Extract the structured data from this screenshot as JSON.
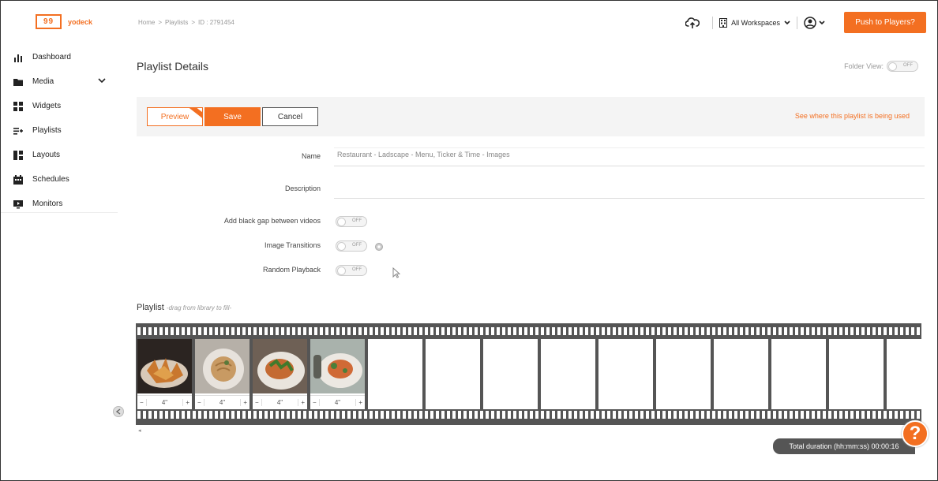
{
  "brand": {
    "logo_mark": "99",
    "name": "yodeck",
    "accent": "#f36f21"
  },
  "sidebar": {
    "items": [
      {
        "label": "Dashboard",
        "icon": "bar-chart-icon"
      },
      {
        "label": "Media",
        "icon": "folder-icon",
        "expandable": true
      },
      {
        "label": "Widgets",
        "icon": "widgets-icon"
      },
      {
        "label": "Playlists",
        "icon": "playlist-icon"
      },
      {
        "label": "Layouts",
        "icon": "layout-icon"
      },
      {
        "label": "Schedules",
        "icon": "calendar-icon"
      },
      {
        "label": "Monitors",
        "icon": "monitor-icon"
      }
    ]
  },
  "header": {
    "breadcrumb": [
      "Home",
      ">",
      "Playlists",
      ">",
      "ID : 2791454"
    ],
    "workspace": "All Workspaces",
    "push_label": "Push to Players?"
  },
  "page": {
    "title": "Playlist Details",
    "folder_view_label": "Folder View:",
    "folder_view_state": "OFF"
  },
  "actions": {
    "preview": "Preview",
    "save": "Save",
    "cancel": "Cancel",
    "see_where": "See where this playlist is being used"
  },
  "form": {
    "name_label": "Name",
    "name_value": "Restaurant - Ladscape - Menu, Ticker & Time - Images",
    "description_label": "Description",
    "description_value": "",
    "black_gap_label": "Add black gap between videos",
    "black_gap_state": "OFF",
    "transitions_label": "Image Transitions",
    "transitions_state": "OFF",
    "random_label": "Random Playback",
    "random_state": "OFF"
  },
  "playlist": {
    "title": "Playlist",
    "hint": "-drag from library to fill-",
    "items": [
      {
        "duration": "4\"",
        "minus": "−",
        "plus": "+"
      },
      {
        "duration": "4\"",
        "minus": "−",
        "plus": "+"
      },
      {
        "duration": "4\"",
        "minus": "−",
        "plus": "+"
      },
      {
        "duration": "4\"",
        "minus": "−",
        "plus": "+"
      }
    ],
    "empty_slots": 10,
    "total_label": "Total duration (hh:mm:ss) 00:00:16"
  },
  "help_label": "?"
}
